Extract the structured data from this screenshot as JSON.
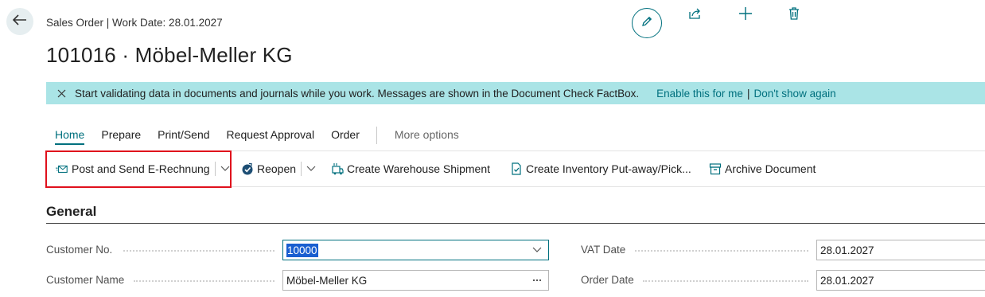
{
  "header": {
    "breadcrumb": "Sales Order | Work Date: 28.01.2027",
    "title": "101016 · Möbel-Meller KG",
    "icons": [
      "back-arrow-icon",
      "pencil-icon",
      "share-icon",
      "plus-icon",
      "trash-icon"
    ]
  },
  "banner": {
    "message": "Start validating data in documents and journals while you work. Messages are shown in the Document Check FactBox.",
    "enable_link": "Enable this for me",
    "separator": "|",
    "dismiss_link": "Don't show again",
    "color": "#aae4e6"
  },
  "tabs": [
    {
      "label": "Home"
    },
    {
      "label": "Prepare"
    },
    {
      "label": "Print/Send"
    },
    {
      "label": "Request Approval"
    },
    {
      "label": "Order"
    },
    {
      "label": "More options"
    }
  ],
  "actions": {
    "post_send": "Post and Send E-Rechnung",
    "reopen": "Reopen",
    "create_shipment": "Create Warehouse Shipment",
    "create_putaway": "Create Inventory Put-away/Pick...",
    "archive": "Archive Document"
  },
  "general": {
    "title": "General",
    "customer_no_label": "Customer No.",
    "customer_no_value": "10000",
    "customer_name_label": "Customer Name",
    "customer_name_value": "Möbel-Meller KG",
    "vat_date_label": "VAT Date",
    "vat_date_value": "28.01.2027",
    "order_date_label": "Order Date",
    "order_date_value": "28.01.2027"
  },
  "colors": {
    "accent": "#00707e",
    "highlight": "#e0101c",
    "selection": "#1a5fd0"
  }
}
